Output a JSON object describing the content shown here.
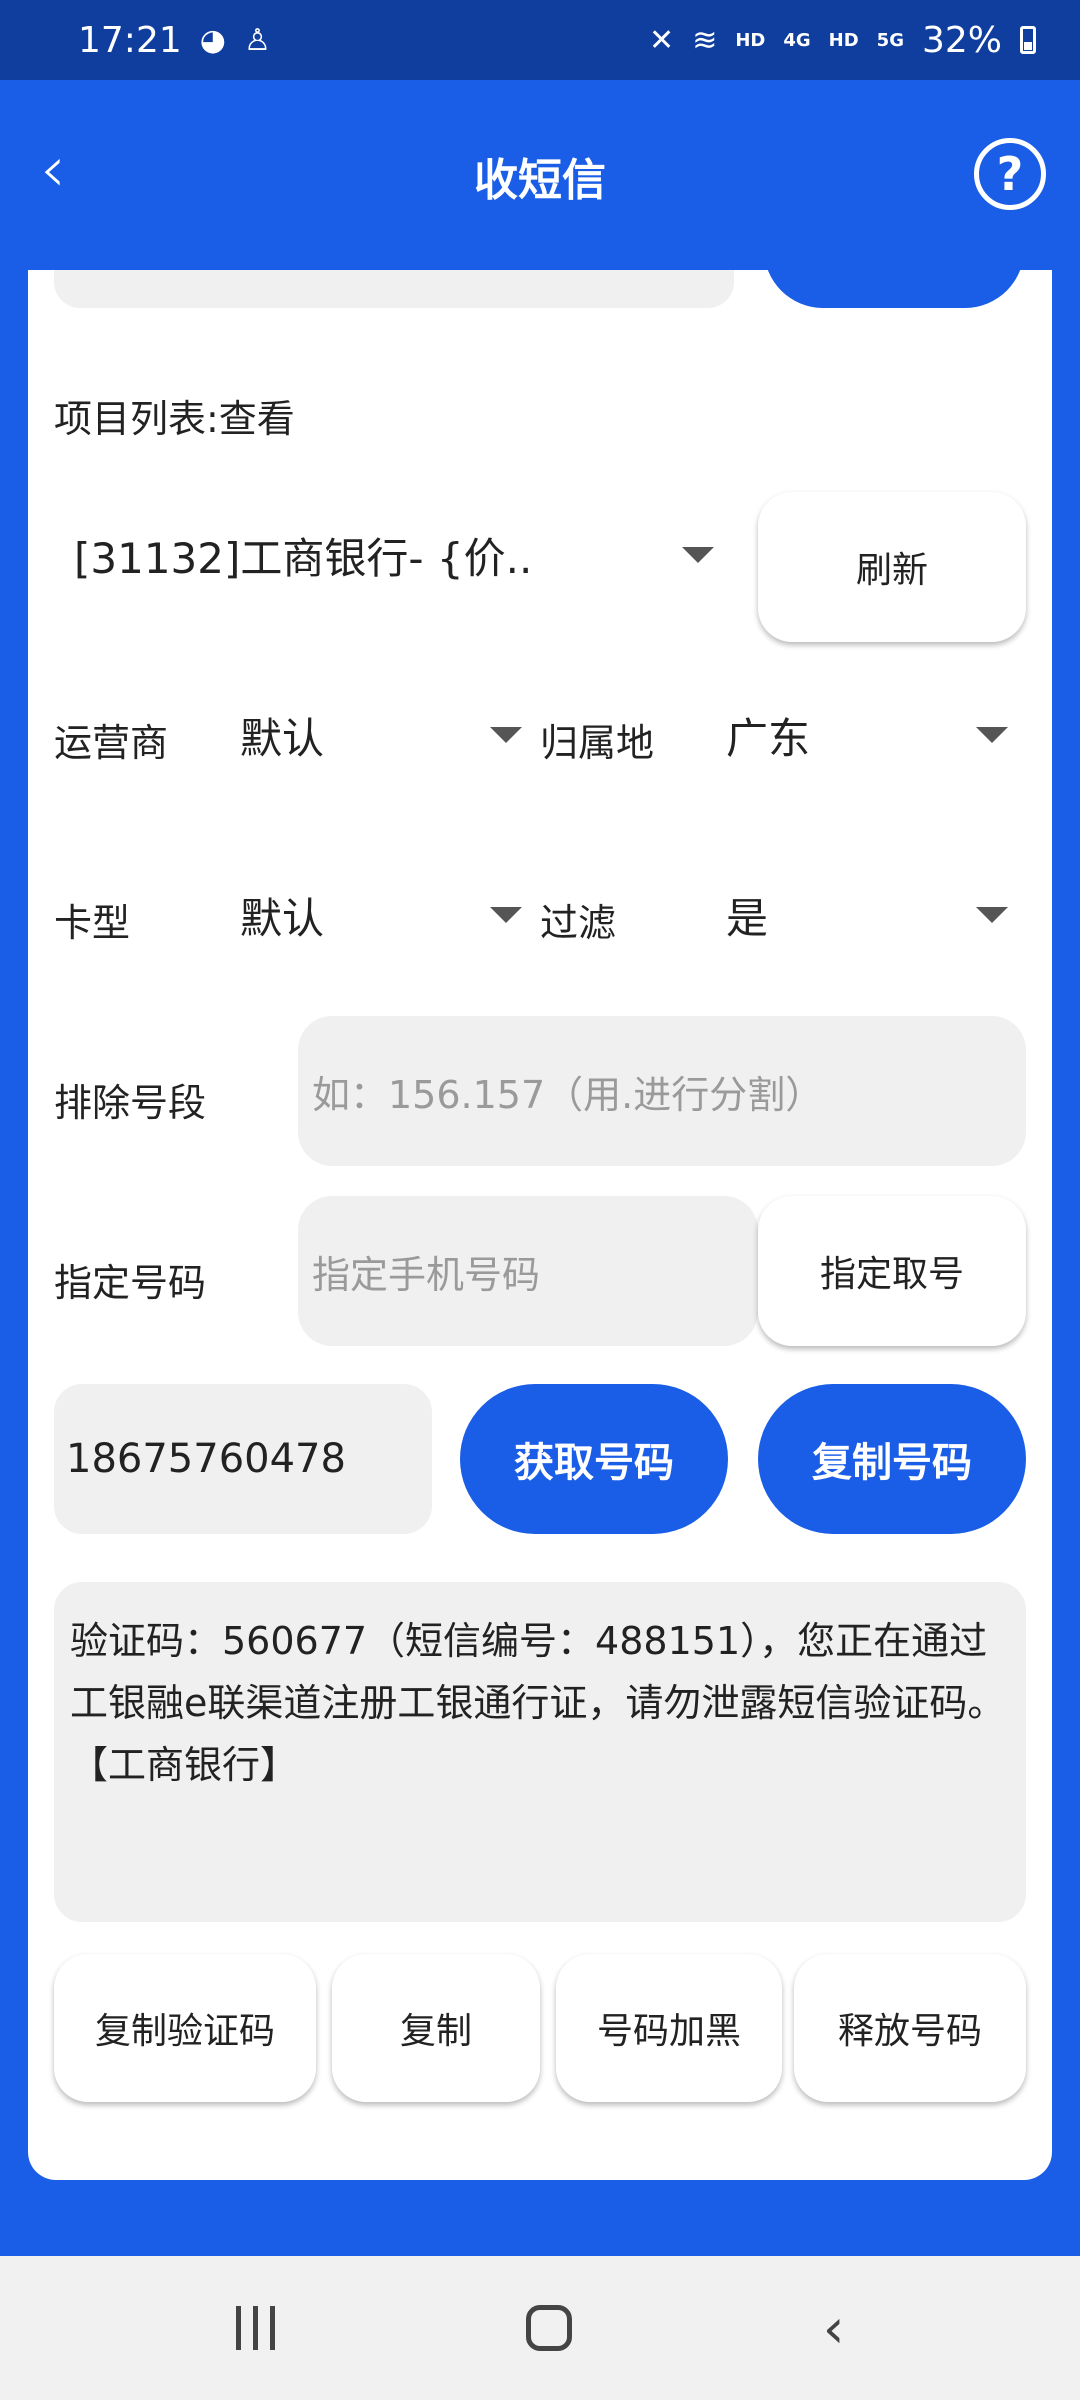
{
  "status_bar": {
    "time": "17:21",
    "left_icons": [
      "wechat-icon",
      "notification-icon"
    ],
    "hd1": "HD",
    "net1": "4G",
    "hd2": "HD",
    "net2": "5G",
    "battery": "32%"
  },
  "app_bar": {
    "title": "收短信",
    "back_icon": "back-arrow-icon",
    "help_symbol": "?"
  },
  "project": {
    "label": "项目列表:查看",
    "selected": "[31132]工商银行- {价..",
    "refresh_label": "刷新"
  },
  "filters": {
    "carrier_label": "运营商",
    "carrier_value": "默认",
    "region_label": "归属地",
    "region_value": "广东",
    "card_type_label": "卡型",
    "card_type_value": "默认",
    "filter_label": "过滤",
    "filter_value": "是"
  },
  "exclude": {
    "label": "排除号段",
    "placeholder": "如：156.157（用.进行分割）"
  },
  "specify": {
    "label": "指定号码",
    "placeholder": "指定手机号码",
    "button_label": "指定取号"
  },
  "number": {
    "value": "18675760478",
    "get_label": "获取号码",
    "copy_label": "复制号码"
  },
  "sms": {
    "content": "验证码：560677（短信编号：488151），您正在通过工银融e联渠道注册工银通行证，请勿泄露短信验证码。【工商银行】"
  },
  "actions": {
    "copy_code": "复制验证码",
    "copy": "复制",
    "blacklist": "号码加黑",
    "release": "释放号码"
  },
  "colors": {
    "primary": "#1a5de6",
    "status_bar": "#0f3e9e",
    "field_bg": "#f0f0f0"
  }
}
